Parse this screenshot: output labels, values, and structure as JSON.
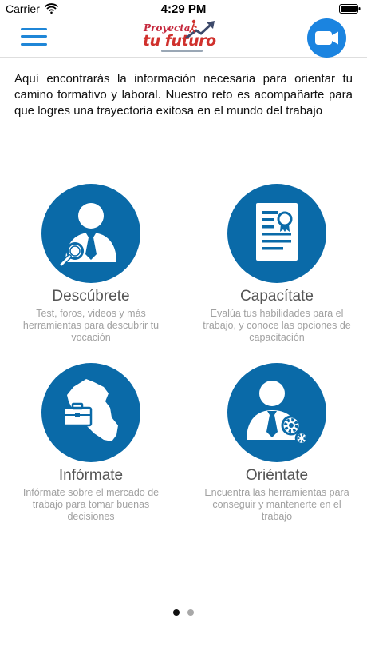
{
  "status_bar": {
    "carrier": "Carrier",
    "time": "4:29 PM"
  },
  "header": {
    "logo": {
      "line1": "Proyecta",
      "line2": "tu futuro"
    },
    "icons": {
      "menu": "hamburger-menu-icon",
      "video": "video-camera-icon"
    }
  },
  "intro_text": "Aquí encontrarás la información necesaria para orientar tu camino formativo y laboral. Nuestro reto es acompañarte para que logres una trayectoria exitosa en el mundo del trabajo",
  "tiles": [
    {
      "title": "Descúbrete",
      "description": "Test, foros, videos y más herramientas para descubrir tu vocación",
      "icon": "person-search-icon"
    },
    {
      "title": "Capacítate",
      "description": "Evalúa tus habilidades para el trabajo, y conoce las opciones de capacitación",
      "icon": "certificate-icon"
    },
    {
      "title": "Infórmate",
      "description": "Infórmate sobre el mercado de trabajo para tomar buenas decisiones",
      "icon": "map-briefcase-icon"
    },
    {
      "title": "Oriéntate",
      "description": "Encuentra las herramientas para conseguir y mantenerte en el trabajo",
      "icon": "person-gears-icon"
    }
  ],
  "pagination": {
    "current_page": 1,
    "total_pages": 2
  },
  "colors": {
    "accent": "#1b84e0",
    "tile_blue": "#0a6aa8",
    "title": "#555555",
    "description": "#a1a1a1"
  }
}
